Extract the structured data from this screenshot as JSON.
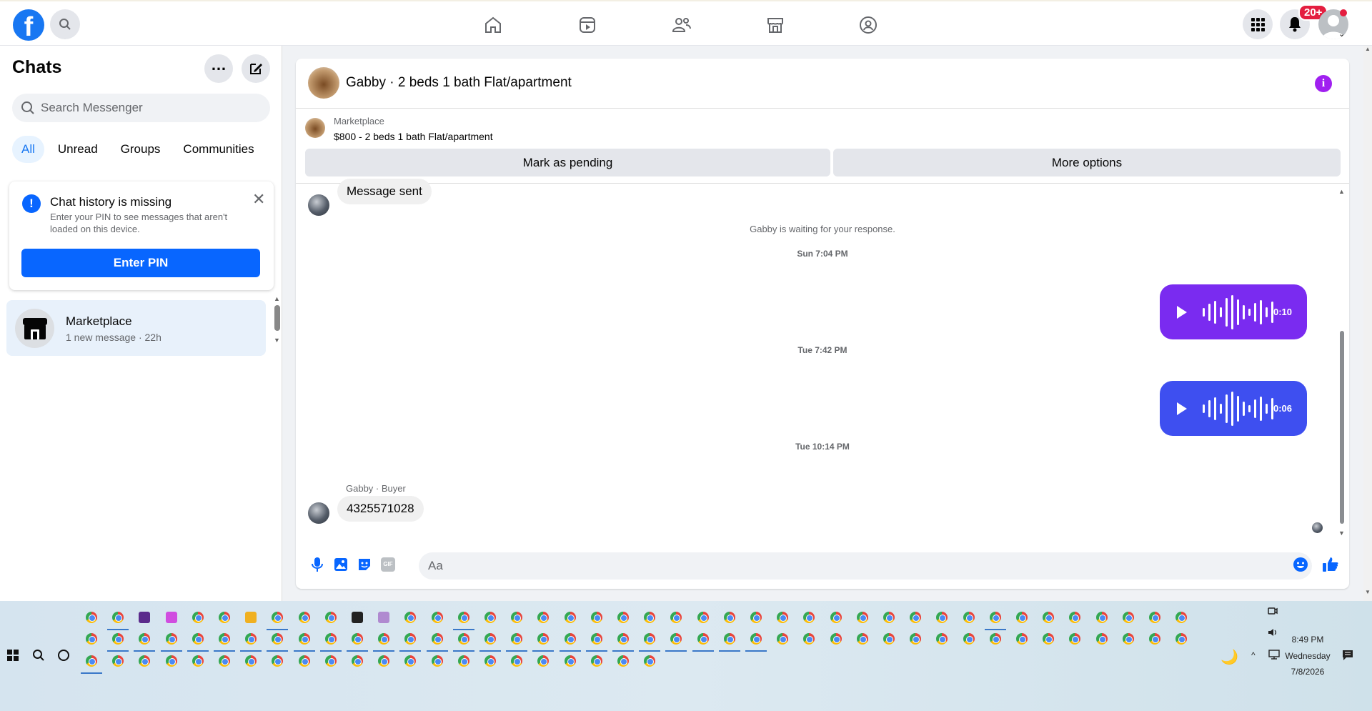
{
  "topbar": {
    "logo": "f",
    "notification_badge": "20+",
    "nav_icons": [
      "home-icon",
      "video-icon",
      "friends-icon",
      "marketplace-icon",
      "groups-icon"
    ]
  },
  "sidebar": {
    "title": "Chats",
    "search_placeholder": "Search Messenger",
    "filters": [
      "All",
      "Unread",
      "Groups",
      "Communities"
    ],
    "notice": {
      "title": "Chat history is missing",
      "body": "Enter your PIN to see messages that aren't loaded on this device.",
      "button": "Enter PIN"
    },
    "chat": {
      "name": "Marketplace",
      "subtitle": "1 new message · 22h"
    }
  },
  "conversation": {
    "title": "Gabby · 2 beds 1 bath Flat/apartment",
    "marketplace_label": "Marketplace",
    "listing": "$800 - 2 beds 1 bath Flat/apartment",
    "btn_pending": "Mark as pending",
    "btn_more": "More options",
    "messages": {
      "sent_text": "Message sent",
      "waiting": "Gabby is waiting for your response.",
      "ts1": "Sun 7:04 PM",
      "voice1_duration": "0:10",
      "ts2": "Tue 7:42 PM",
      "voice2_duration": "0:06",
      "ts3": "Tue 10:14 PM",
      "sender_label": "Gabby · Buyer",
      "phone": "4325571028"
    },
    "composer_placeholder": "Aa"
  },
  "taskbar": {
    "time": "8:49 PM",
    "day": "Wednesday",
    "date": "7/8/2026"
  },
  "colors": {
    "fb_blue": "#1877f2",
    "voice1": "#7a2bf0",
    "voice2": "#3e4ff0",
    "info_purple": "#a020f0"
  }
}
